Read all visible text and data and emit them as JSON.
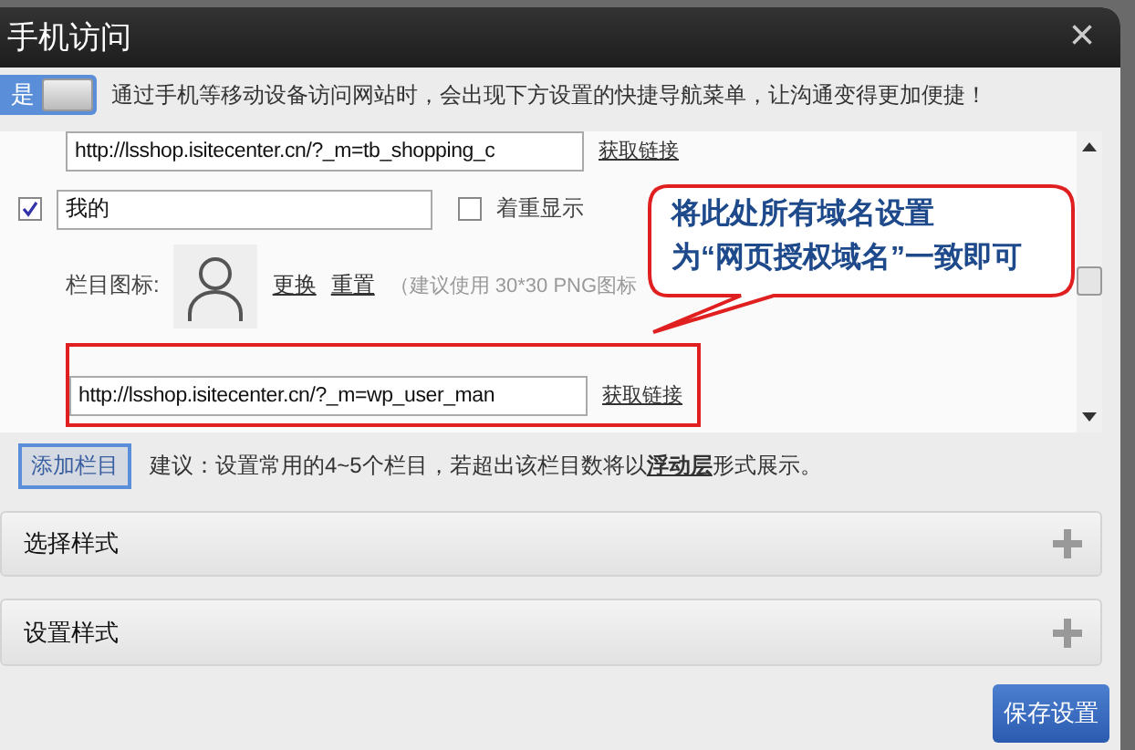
{
  "window": {
    "title": "手机访问",
    "close": "×"
  },
  "toggle": {
    "label": "是",
    "on": true
  },
  "intro": "通过手机等移动设备访问网站时，会出现下方设置的快捷导航菜单，让沟通变得更加便捷！",
  "menu_items": [
    {
      "kind": "link_only",
      "url": "http://lsshop.isitecenter.cn/?_m=tb_shopping_c",
      "link": "获取链接"
    },
    {
      "kind": "item",
      "checked": true,
      "name": "我的",
      "emphasis_label": "着重显示",
      "emphasis_checked": false,
      "icon_label": "栏目图标:",
      "change": "更换",
      "reset": "重置",
      "hint": "（建议使用 30*30 PNG图标",
      "url": "http://lsshop.isitecenter.cn/?_m=wp_user_man",
      "link": "获取链接",
      "highlighted": true
    }
  ],
  "callout": [
    "将此处所有域名设置",
    "为“网页授权域名”一致即可"
  ],
  "add_button": "添加栏目",
  "suggestion": "建议：设置常用的4~5个栏目，若超出该栏目数将以**浮动层**形式展示。",
  "sections": [
    {
      "title": "选择样式",
      "expanded": false
    },
    {
      "title": "设置样式",
      "expanded": false
    }
  ],
  "save_button": "保存设置"
}
